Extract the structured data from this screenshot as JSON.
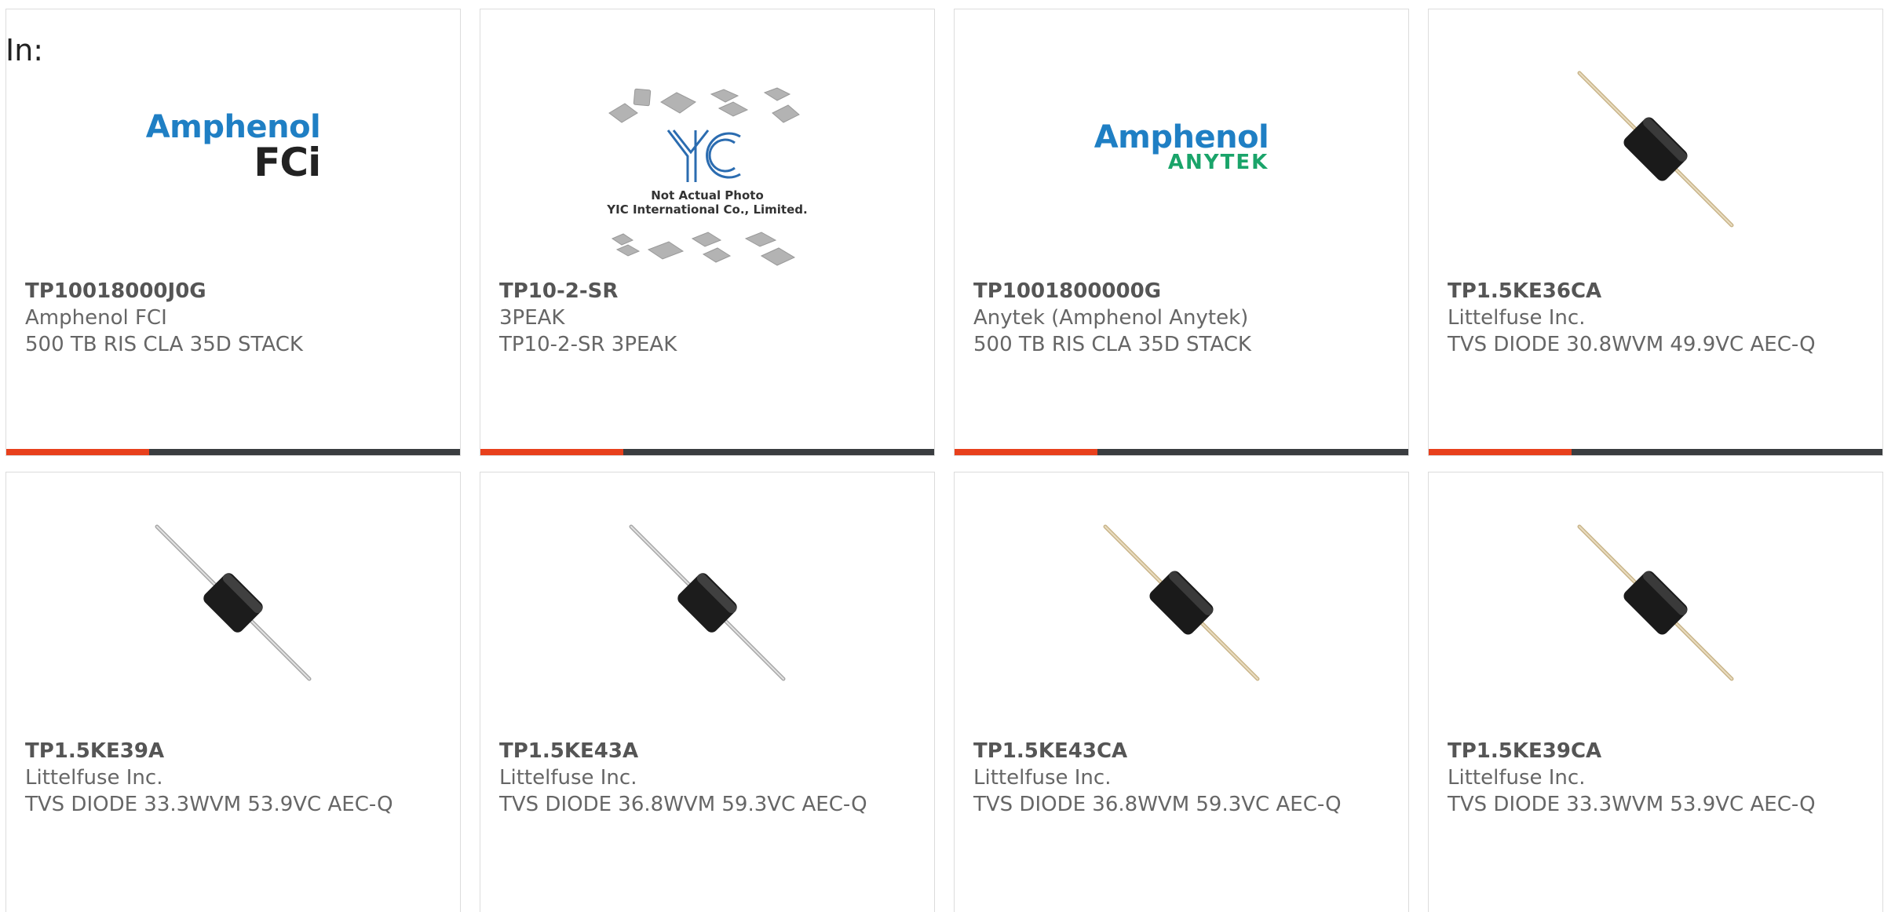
{
  "header": {
    "in_label": "In:"
  },
  "colors": {
    "accent": "#e8401c",
    "bar": "#3a3d40",
    "text": "#666666"
  },
  "products": [
    {
      "part_number": "TP10018000J0G",
      "manufacturer": "Amphenol FCI",
      "description": "500 TB RIS CLA 35D STACK",
      "image": "amphenol-fci-logo",
      "logo_main": "Amphenol",
      "logo_sub": "FCi"
    },
    {
      "part_number": "TP10-2-SR",
      "manufacturer": "3PEAK",
      "description": "TP10-2-SR 3PEAK",
      "image": "yic-placeholder",
      "logo_main": "YIC",
      "logo_caption_1": "Not Actual Photo",
      "logo_caption_2": "YIC International Co., Limited."
    },
    {
      "part_number": "TP1001800000G",
      "manufacturer": "Anytek (Amphenol Anytek)",
      "description": "500 TB RIS CLA 35D STACK",
      "image": "amphenol-anytek-logo",
      "logo_main": "Amphenol",
      "logo_sub": "ANYTEK"
    },
    {
      "part_number": "TP1.5KE36CA",
      "manufacturer": "Littelfuse Inc.",
      "description": "TVS DIODE 30.8WVM 49.9VC AEC-Q",
      "image": "axial-diode"
    },
    {
      "part_number": "TP1.5KE39A",
      "manufacturer": "Littelfuse Inc.",
      "description": "TVS DIODE 33.3WVM 53.9VC AEC-Q",
      "image": "axial-diode-silver"
    },
    {
      "part_number": "TP1.5KE43A",
      "manufacturer": "Littelfuse Inc.",
      "description": "TVS DIODE 36.8WVM 59.3VC AEC-Q",
      "image": "axial-diode-silver"
    },
    {
      "part_number": "TP1.5KE43CA",
      "manufacturer": "Littelfuse Inc.",
      "description": "TVS DIODE 36.8WVM 59.3VC AEC-Q",
      "image": "axial-diode"
    },
    {
      "part_number": "TP1.5KE39CA",
      "manufacturer": "Littelfuse Inc.",
      "description": "TVS DIODE 33.3WVM 53.9VC AEC-Q",
      "image": "axial-diode"
    }
  ]
}
